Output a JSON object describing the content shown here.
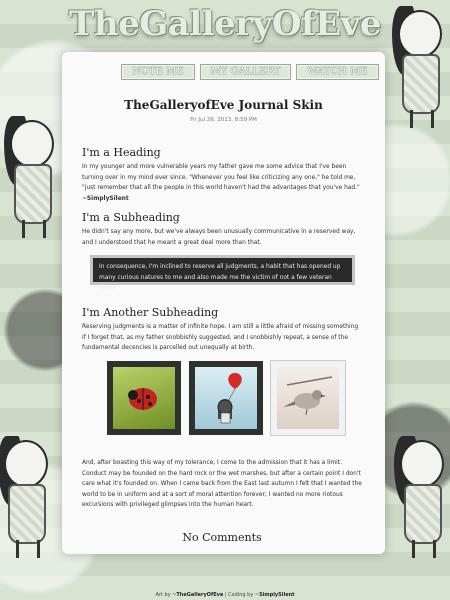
{
  "site": {
    "title": "TheGalleryOfEve"
  },
  "nav": [
    {
      "label": "NOTE ME"
    },
    {
      "label": "MY GALLERY"
    },
    {
      "label": "WATCH ME"
    }
  ],
  "journal": {
    "title": "TheGalleryofEve Journal Skin",
    "date": "Fri Jul 26, 2013, 8:59 PM"
  },
  "sections": {
    "heading": "I'm a Heading",
    "heading_text": "In my younger and more vulnerable years my father gave me some advice that I've been turning over in my mind ever since. \"Whenever you feel like criticizing any one,\" he told me, \"just remember that all the people in this world haven't had the advantages that you've had.\"",
    "heading_sig": "~SimplySilent",
    "subheading": "I'm a Subheading",
    "subheading_text": "He didn't say any more, but we've always been unusually communicative in a reserved way, and I understood that he meant a great deal more than that.",
    "quote": "In consequence, I'm inclined to reserve all judgments, a habit that has opened up many curious natures to me and also made me the victim of not a few veteran bores.",
    "another_subheading": "I'm Another Subheading",
    "another_text": "Reserving judgments is a matter of infinite hope. I am still a little afraid of missing something if I forget that, as my father snobbishly suggested, and I snobbishly repeat, a sense of the fundamental decencies is parcelled out unequally at birth.",
    "closing_text": "And, after boasting this way of my tolerance, I come to the admission that it has a limit. Conduct may be founded on the hard rock or the wet marshes, but after a certain point I don't care what it's founded on. When I came back from the East last autumn I felt that I wanted the world to be in uniform and at a sort of moral attention forever; I wanted no more riotous excursions with privileged glimpses into the human heart.",
    "comments": "No Comments"
  },
  "footer": {
    "prefix": "Art by ~",
    "art": "TheGalleryOfEve",
    "mid": " | Coding by ~",
    "code": "SimplySilent"
  }
}
